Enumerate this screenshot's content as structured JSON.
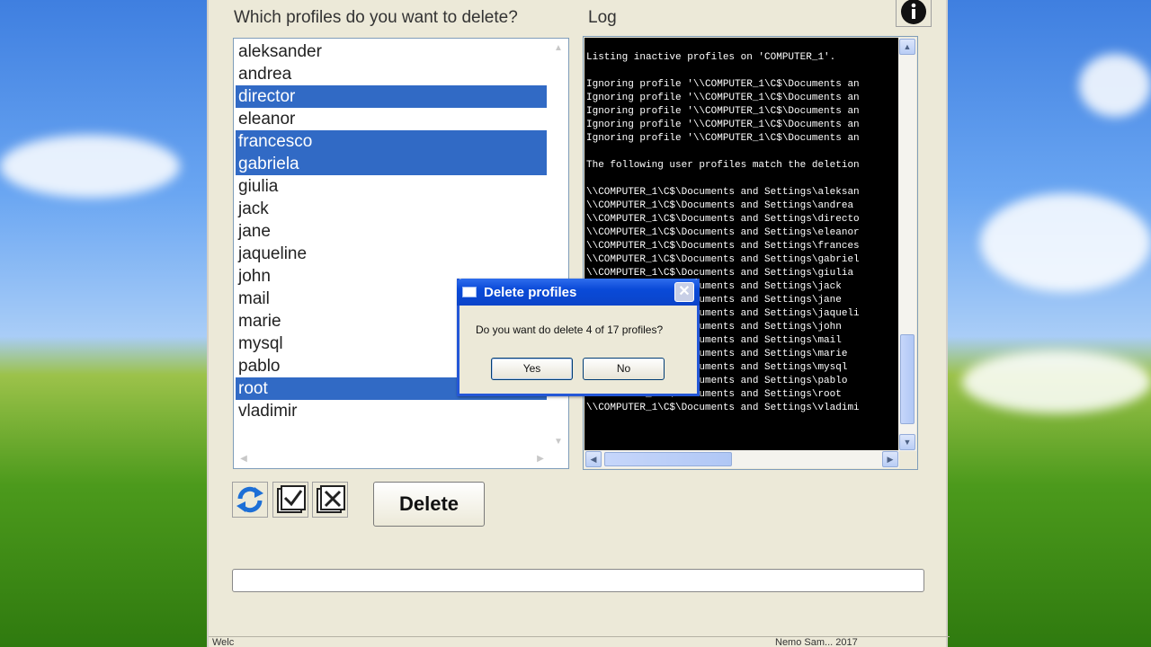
{
  "window": {
    "profiles_label": "Which profiles do you want to delete?",
    "log_label": "Log",
    "profiles": [
      {
        "name": "aleksander",
        "selected": false
      },
      {
        "name": "andrea",
        "selected": false
      },
      {
        "name": "director",
        "selected": true
      },
      {
        "name": "eleanor",
        "selected": false
      },
      {
        "name": "francesco",
        "selected": true
      },
      {
        "name": "gabriela",
        "selected": true
      },
      {
        "name": "giulia",
        "selected": false
      },
      {
        "name": "jack",
        "selected": false
      },
      {
        "name": "jane",
        "selected": false
      },
      {
        "name": "jaqueline",
        "selected": false
      },
      {
        "name": "john",
        "selected": false
      },
      {
        "name": "mail",
        "selected": false
      },
      {
        "name": "marie",
        "selected": false
      },
      {
        "name": "mysql",
        "selected": false
      },
      {
        "name": "pablo",
        "selected": false
      },
      {
        "name": "root",
        "selected": true
      },
      {
        "name": "vladimir",
        "selected": false
      }
    ],
    "log_lines": [
      "",
      "Listing inactive profiles on 'COMPUTER_1'.",
      "",
      "Ignoring profile '\\\\COMPUTER_1\\C$\\Documents an",
      "Ignoring profile '\\\\COMPUTER_1\\C$\\Documents an",
      "Ignoring profile '\\\\COMPUTER_1\\C$\\Documents an",
      "Ignoring profile '\\\\COMPUTER_1\\C$\\Documents an",
      "Ignoring profile '\\\\COMPUTER_1\\C$\\Documents an",
      "",
      "The following user profiles match the deletion",
      "",
      "\\\\COMPUTER_1\\C$\\Documents and Settings\\aleksan",
      "\\\\COMPUTER_1\\C$\\Documents and Settings\\andrea",
      "\\\\COMPUTER_1\\C$\\Documents and Settings\\directo",
      "\\\\COMPUTER_1\\C$\\Documents and Settings\\eleanor",
      "\\\\COMPUTER_1\\C$\\Documents and Settings\\frances",
      "\\\\COMPUTER_1\\C$\\Documents and Settings\\gabriel",
      "\\\\COMPUTER_1\\C$\\Documents and Settings\\giulia",
      "\\\\COMPUTER_1\\C$\\Documents and Settings\\jack",
      "\\\\COMPUTER_1\\C$\\Documents and Settings\\jane",
      "\\\\COMPUTER_1\\C$\\Documents and Settings\\jaqueli",
      "\\\\COMPUTER_1\\C$\\Documents and Settings\\john",
      "\\\\COMPUTER_1\\C$\\Documents and Settings\\mail",
      "\\\\COMPUTER_1\\C$\\Documents and Settings\\marie",
      "\\\\COMPUTER_1\\C$\\Documents and Settings\\mysql",
      "\\\\COMPUTER_1\\C$\\Documents and Settings\\pablo",
      "\\\\COMPUTER_1\\C$\\Documents and Settings\\root",
      "\\\\COMPUTER_1\\C$\\Documents and Settings\\vladimi"
    ],
    "delete_label": "Delete",
    "refresh_icon": "refresh-icon",
    "check_all_icon": "check-all-icon",
    "uncheck_all_icon": "uncheck-all-icon",
    "info_icon": "info-icon",
    "status_left": "Welc",
    "status_right": "Nemo Sam... 2017"
  },
  "dialog": {
    "title": "Delete profiles",
    "message": "Do you want do delete 4 of 17 profiles?",
    "yes_label": "Yes",
    "no_label": "No",
    "close_glyph": "✕"
  },
  "colors": {
    "selection": "#316ac5",
    "titlebar": "#0a4ad8",
    "window_bg": "#ece9d8",
    "log_bg": "#000000"
  }
}
